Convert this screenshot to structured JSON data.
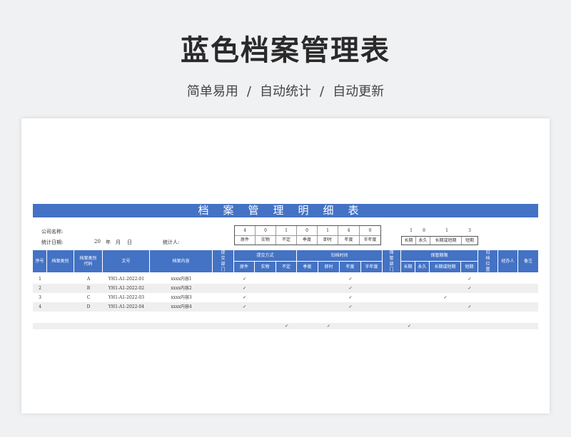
{
  "hero": {
    "title": "蓝色档案管理表",
    "sub1": "简单易用",
    "sub2": "自动统计",
    "sub3": "自动更新",
    "sep": "/"
  },
  "sheet": {
    "title": "档案管理明细表",
    "company_label": "公司名称:",
    "date_label": "统计日期:",
    "date_year": "20",
    "date_year_unit": "年",
    "date_month_unit": "月",
    "date_day_unit": "日",
    "stat_person_label": "统计人:",
    "counts_a": [
      {
        "value": "4",
        "label": "原件"
      },
      {
        "value": "0",
        "label": "实物"
      },
      {
        "value": "1",
        "label": "不定"
      },
      {
        "value": "0",
        "label": "季度"
      },
      {
        "value": "1",
        "label": "即时"
      },
      {
        "value": "4",
        "label": "年度"
      },
      {
        "value": "0",
        "label": "半年度"
      }
    ],
    "counts_b": [
      {
        "value": "1",
        "label": "长期"
      },
      {
        "value": "0",
        "label": "永久"
      },
      {
        "value": "1",
        "label": "长期或短期"
      },
      {
        "value": "3",
        "label": "短期"
      }
    ]
  },
  "headers": {
    "seq": "序号",
    "type": "档案类别",
    "type_code": "档案类别代码",
    "doc_no": "文号",
    "content": "档案内容",
    "dept": "提交部门",
    "submit_group": "提交方式",
    "submit_cols": [
      "原件",
      "实物",
      "不定"
    ],
    "archive_group": "归档时间",
    "archive_cols": [
      "季度",
      "即时",
      "年度",
      "半年度"
    ],
    "keep_dept": "保管部门",
    "period_group": "保管期限",
    "period_cols": [
      "长期",
      "永久",
      "长期或短期",
      "短期"
    ],
    "location": "归档位置",
    "handler": "经办人",
    "remark": "备注"
  },
  "rows": [
    {
      "seq": "1",
      "code": "A",
      "doc": "YH1-A1-2022-01",
      "content": "xxxx内容1",
      "submit": "✓",
      "archive": "✓",
      "period": "✓"
    },
    {
      "seq": "2",
      "code": "B",
      "doc": "YH1-A1-2022-02",
      "content": "xxxx内容2",
      "submit": "✓",
      "archive": "✓",
      "period": "✓"
    },
    {
      "seq": "3",
      "code": "C",
      "doc": "YH1-A1-2022-03",
      "content": "xxxx内容3",
      "submit": "✓",
      "archive": "✓",
      "period": "✓"
    },
    {
      "seq": "4",
      "code": "D",
      "doc": "YH1-A1-2022-04",
      "content": "xxxx内容4",
      "submit": "✓",
      "archive": "✓",
      "period": "✓"
    }
  ],
  "footer_checks": [
    "✓",
    "✓",
    "✓"
  ]
}
